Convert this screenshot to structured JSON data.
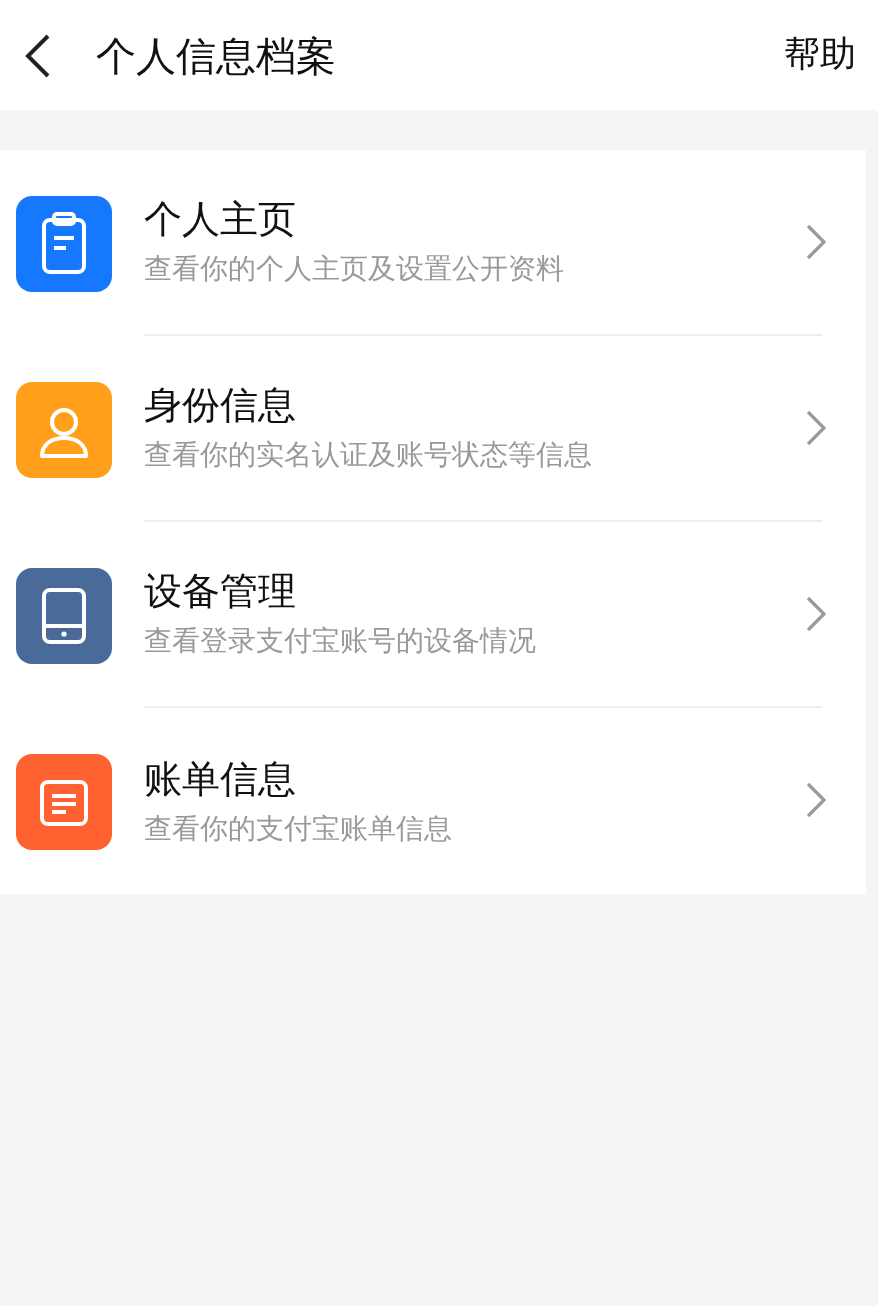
{
  "header": {
    "title": "个人信息档案",
    "action": "帮助"
  },
  "items": [
    {
      "kind": "clipboard",
      "color": "#1677ff",
      "title": "个人主页",
      "subtitle": "查看你的个人主页及设置公开资料"
    },
    {
      "kind": "person",
      "color": "#ff9f1a",
      "title": "身份信息",
      "subtitle": "查看你的实名认证及账号状态等信息"
    },
    {
      "kind": "tablet",
      "color": "#4a6a9a",
      "title": "设备管理",
      "subtitle": "查看登录支付宝账号的设备情况"
    },
    {
      "kind": "document",
      "color": "#ff6130",
      "title": "账单信息",
      "subtitle": "查看你的支付宝账单信息"
    }
  ]
}
